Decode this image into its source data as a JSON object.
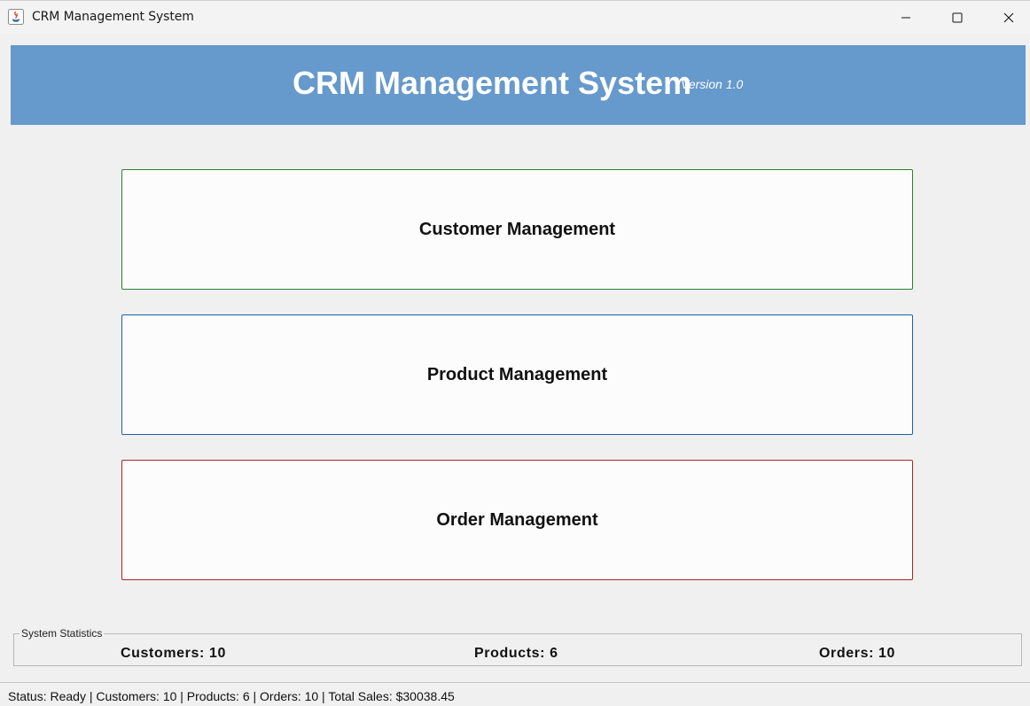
{
  "window": {
    "title": "CRM Management System",
    "icon": "java-app-icon",
    "controls": [
      "minimize-icon",
      "maximize-icon",
      "close-icon"
    ]
  },
  "header": {
    "title": "CRM Management System",
    "version": "Version 1.0",
    "background_color": "#6699cc"
  },
  "modules": {
    "customer": {
      "label": "Customer Management",
      "border_color": "#2e7d32"
    },
    "product": {
      "label": "Product Management",
      "border_color": "#1e5fa8"
    },
    "order": {
      "label": "Order Management",
      "border_color": "#b22222"
    }
  },
  "statistics": {
    "legend": "System Statistics",
    "customers": "Customers: 10",
    "products": "Products: 6",
    "orders": "Orders: 10"
  },
  "statusbar": {
    "text": "Status: Ready | Customers: 10 | Products: 6 | Orders: 10 | Total Sales: $30038.45"
  }
}
